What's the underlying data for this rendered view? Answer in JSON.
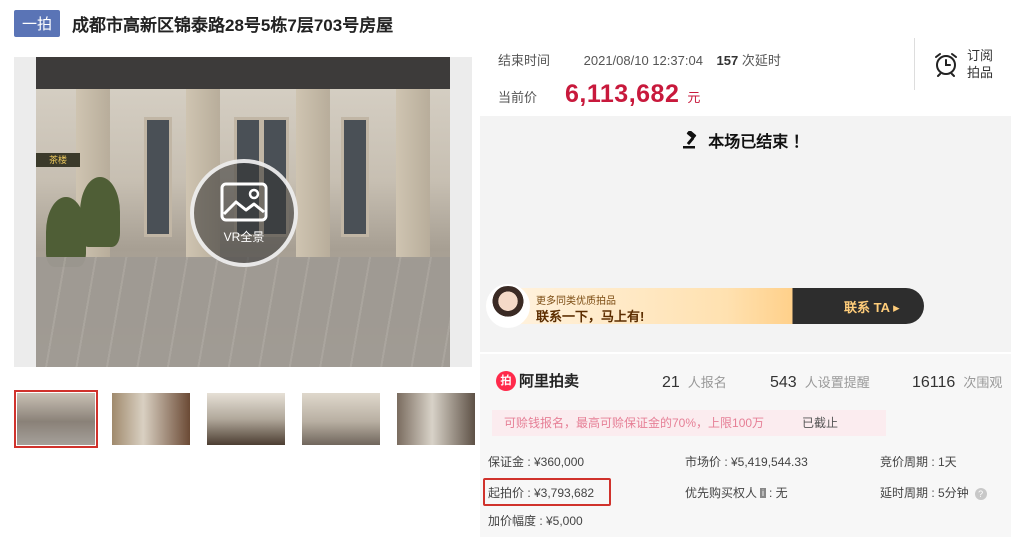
{
  "header": {
    "tag": "一拍",
    "title": "成都市高新区锦泰路28号5栋7层703号房屋"
  },
  "gallery": {
    "vr_label": "VR全景",
    "shop_sign": "茶楼",
    "thumb_count": 5
  },
  "auction": {
    "end_label": "结束时间",
    "end_time": "2021/08/10 12:37:04",
    "delay_count": "157",
    "delay_label": "次延时",
    "current_price_label": "当前价",
    "current_price": "6,113,682",
    "currency": "元",
    "subscribe_label_1": "订阅",
    "subscribe_label_2": "拍品",
    "ended_text": "本场已结束 ！"
  },
  "banner": {
    "line1": "更多同类优质拍品",
    "line2": "联系一下，马上有!",
    "cta": "联系 TA ▸"
  },
  "stats": {
    "logo_text": "阿里拍卖",
    "signups": "21",
    "signups_label": "人报名",
    "reminders": "543",
    "reminders_label": "人设置提醒",
    "views": "16116",
    "views_label": "次围观"
  },
  "notice": {
    "text": "可赊钱报名，最高可赊保证金的70%，上限100万",
    "status": "已截止"
  },
  "details": {
    "deposit": "保证金 : ¥360,000",
    "market_price": "市场价 : ¥5,419,544.33",
    "bid_cycle": "竞价周期 : 1天",
    "start_price": "起拍价 : ¥3,793,682",
    "priority_label": "优先购买权人",
    "priority_badge": "i",
    "priority_value": ": 无",
    "delay_cycle": "延时周期 : 5分钟",
    "increment": "加价幅度 : ¥5,000"
  },
  "colors": {
    "price_red": "#c8193c",
    "tag_blue": "#5a74b6",
    "highlight_red": "#d0322c"
  }
}
